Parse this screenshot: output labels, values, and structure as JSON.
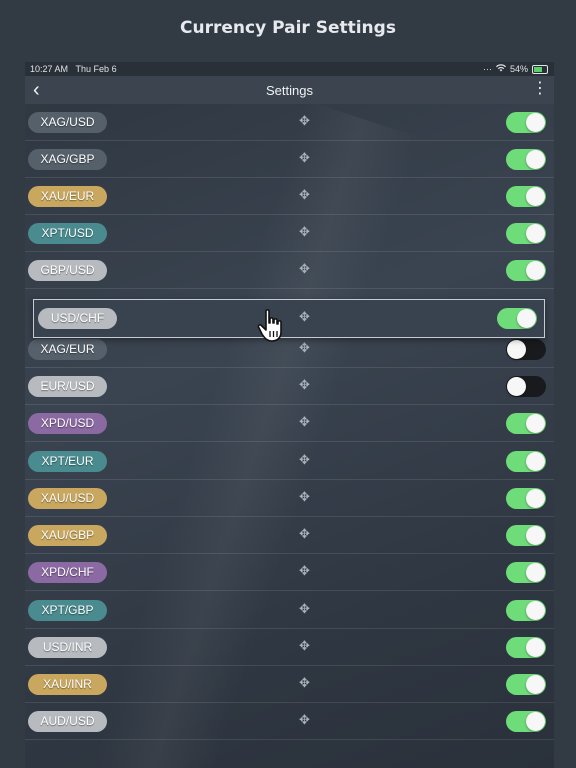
{
  "page_title": "Currency Pair Settings",
  "status": {
    "time": "10:27 AM",
    "date": "Thu Feb 6",
    "signal": "···",
    "battery": "54%"
  },
  "nav": {
    "back_icon": "‹",
    "title": "Settings",
    "more_icon": "⋮"
  },
  "colors": {
    "gray": "#55606b",
    "gray_light": "#b7bbbf",
    "gold": "#c9a75e",
    "teal": "#4a8b8f",
    "purple": "#8b69a3",
    "toggle_on": "#6fdc7a",
    "toggle_off": "#181a1d"
  },
  "grip_icon": "✥",
  "rows": [
    {
      "label": "XAG/USD",
      "color": "gray",
      "on": true
    },
    {
      "label": "XAG/GBP",
      "color": "gray",
      "on": true
    },
    {
      "label": "XAU/EUR",
      "color": "gold",
      "on": true
    },
    {
      "label": "XPT/USD",
      "color": "teal",
      "on": true
    },
    {
      "label": "GBP/USD",
      "color": "gray_light",
      "on": true
    },
    {
      "label": "XAG/EUR",
      "color": "gray",
      "on": false
    },
    {
      "label": "EUR/USD",
      "color": "gray_light",
      "on": false
    },
    {
      "label": "XPD/USD",
      "color": "purple",
      "on": true
    },
    {
      "label": "XPT/EUR",
      "color": "teal",
      "on": true
    },
    {
      "label": "XAU/USD",
      "color": "gold",
      "on": true
    },
    {
      "label": "XAU/GBP",
      "color": "gold",
      "on": true
    },
    {
      "label": "XPD/CHF",
      "color": "purple",
      "on": true
    },
    {
      "label": "XPT/GBP",
      "color": "teal",
      "on": true
    },
    {
      "label": "USD/INR",
      "color": "gray_light",
      "on": true
    },
    {
      "label": "XAU/INR",
      "color": "gold",
      "on": true
    },
    {
      "label": "AUD/USD",
      "color": "gray_light",
      "on": true
    }
  ],
  "dragging": {
    "label": "USD/CHF",
    "color": "gray_light",
    "on": true
  }
}
